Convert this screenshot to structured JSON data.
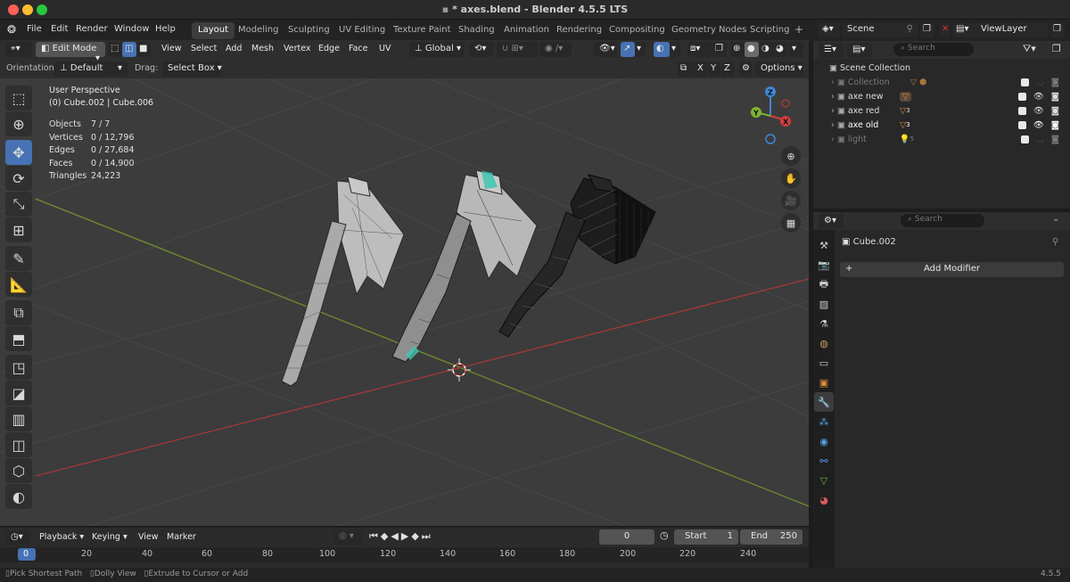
{
  "window": {
    "title": "* axes.blend - Blender 4.5.5 LTS"
  },
  "menu": [
    "File",
    "Edit",
    "Render",
    "Window",
    "Help"
  ],
  "workspaces": [
    "Layout",
    "Modeling",
    "Sculpting",
    "UV Editing",
    "Texture Paint",
    "Shading",
    "Animation",
    "Rendering",
    "Compositing",
    "Geometry Nodes",
    "Scripting"
  ],
  "workspace_add": "+",
  "scene": {
    "name": "Scene",
    "view_layer": "ViewLayer"
  },
  "header": {
    "mode": "Edit Mode",
    "menus": [
      "View",
      "Select",
      "Add",
      "Mesh",
      "Vertex",
      "Edge",
      "Face",
      "UV"
    ],
    "transform": "Global"
  },
  "header2": {
    "orientation_label": "Orientation:",
    "orientation_value": "Default",
    "drag_label": "Drag:",
    "drag_value": "Select Box",
    "axes": [
      "X",
      "Y",
      "Z"
    ],
    "options": "Options"
  },
  "overlay": {
    "view_name": "User Perspective",
    "object_line": "(0) Cube.002 | Cube.006"
  },
  "stats": [
    {
      "label": "Objects",
      "value": "7 / 7"
    },
    {
      "label": "Vertices",
      "value": "0 / 12,796"
    },
    {
      "label": "Edges",
      "value": "0 / 27,684"
    },
    {
      "label": "Faces",
      "value": "0 / 14,900"
    },
    {
      "label": "Triangles",
      "value": "24,223"
    }
  ],
  "gizmo": {
    "z": "Z",
    "y": "Y",
    "x": "X"
  },
  "timeline": {
    "menus": [
      "Playback",
      "Keying",
      "View",
      "Marker"
    ],
    "current_frame": "0",
    "start_label": "Start",
    "start": "1",
    "end_label": "End",
    "end": "250",
    "ticks": [
      "0",
      "20",
      "40",
      "60",
      "80",
      "100",
      "120",
      "140",
      "160",
      "180",
      "200",
      "220",
      "240"
    ]
  },
  "status": {
    "items": [
      "Pick Shortest Path",
      "Dolly View",
      "Extrude to Cursor or Add"
    ],
    "version": "4.5.5"
  },
  "outliner": {
    "search_placeholder": "Search",
    "root": "Scene Collection",
    "rows": [
      {
        "name": "Collection",
        "dim": true,
        "badge": ""
      },
      {
        "name": "axe new",
        "dim": false,
        "badge": ""
      },
      {
        "name": "axe red",
        "dim": false,
        "badge": "3"
      },
      {
        "name": "axe old",
        "dim": false,
        "badge": "3"
      },
      {
        "name": "light",
        "dim": true,
        "badge": "5"
      }
    ]
  },
  "properties": {
    "search_placeholder": "Search",
    "object": "Cube.002",
    "add_modifier": "Add Modifier"
  },
  "colors": {
    "accent": "#4772b3",
    "x_axis": "#d33c3c",
    "y_axis": "#7fb532",
    "z_axis": "#3f86d8"
  }
}
